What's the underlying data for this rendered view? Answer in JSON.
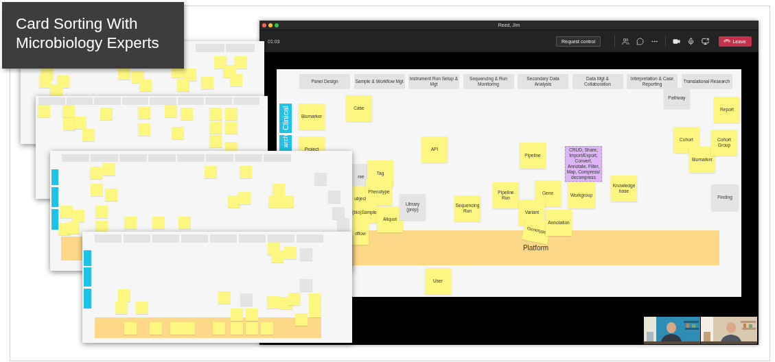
{
  "title_banner": {
    "text": "Card Sorting With Microbiology Experts"
  },
  "call_window": {
    "title": "Reed, Jim",
    "timer": "01:03",
    "request_button": "Request control",
    "leave_button": "Leave",
    "board": {
      "headers": [
        "Panel Design",
        "Sample & Workflow Mgt",
        "Instrument Run Setup & Mgt",
        "Sequencing & Run Monitoring",
        "Secondary Data Analysis",
        "Data Mgt & Collaboration",
        "Interpretation & Case Reporting",
        "Translational Research"
      ],
      "lanes": [
        "Clinical",
        "arch"
      ],
      "band": {
        "text": "Platform"
      },
      "stickies": [
        {
          "text": "Biomarker",
          "kind": "note"
        },
        {
          "text": "Case",
          "kind": "note"
        },
        {
          "text": "Pathway",
          "kind": "category"
        },
        {
          "text": "Report",
          "kind": "note"
        },
        {
          "text": "Project",
          "kind": "note"
        },
        {
          "text": "API",
          "kind": "note"
        },
        {
          "text": "Pipeline",
          "kind": "note"
        },
        {
          "text": "CRUD, Share, Import/Export, Convert, Annotate, Filter, Map, Compress/ decompress",
          "kind": "action"
        },
        {
          "text": "Cohort",
          "kind": "note"
        },
        {
          "text": "Biomarker",
          "kind": "note"
        },
        {
          "text": "Cohort Group",
          "kind": "note"
        },
        {
          "text": "ree",
          "kind": "category"
        },
        {
          "text": "ubject",
          "kind": "note"
        },
        {
          "text": "Tag",
          "kind": "note"
        },
        {
          "text": "Phenotype",
          "kind": "note"
        },
        {
          "text": "Pipeline Run",
          "kind": "note"
        },
        {
          "text": "Gene",
          "kind": "note"
        },
        {
          "text": "Workgroup",
          "kind": "note"
        },
        {
          "text": "Knowledge base",
          "kind": "note"
        },
        {
          "text": "Finding",
          "kind": "category"
        },
        {
          "text": "(bio)Sample",
          "kind": "note"
        },
        {
          "text": "dflow",
          "kind": "note"
        },
        {
          "text": "Aliquot",
          "kind": "note"
        },
        {
          "text": "Library (prep)",
          "kind": "category"
        },
        {
          "text": "Sequencing Run",
          "kind": "note"
        },
        {
          "text": "Variant",
          "kind": "note"
        },
        {
          "text": "Genotype",
          "kind": "note"
        },
        {
          "text": "Annotation",
          "kind": "note"
        },
        {
          "text": "User",
          "kind": "note"
        }
      ]
    }
  }
}
